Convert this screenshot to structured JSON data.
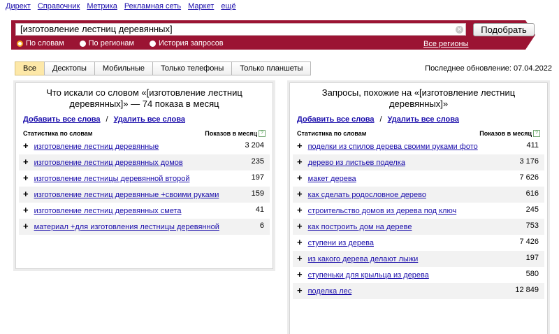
{
  "topnav": [
    {
      "label": "Директ"
    },
    {
      "label": "Справочник"
    },
    {
      "label": "Метрика"
    },
    {
      "label": "Рекламная сеть"
    },
    {
      "label": "Маркет"
    },
    {
      "label": "ещё"
    }
  ],
  "search": {
    "query": "[изготовление лестниц деревянных]",
    "submit_label": "Подобрать",
    "clear_glyph": "✕",
    "modes": [
      {
        "label": "По словам",
        "selected": true
      },
      {
        "label": "По регионам",
        "selected": false
      },
      {
        "label": "История запросов",
        "selected": false
      }
    ],
    "regions_link": "Все регионы"
  },
  "device_tabs": [
    {
      "label": "Все",
      "active": true
    },
    {
      "label": "Десктопы",
      "active": false
    },
    {
      "label": "Мобильные",
      "active": false
    },
    {
      "label": "Только телефоны",
      "active": false
    },
    {
      "label": "Только планшеты",
      "active": false
    }
  ],
  "last_update": "Последнее обновление: 07.04.2022",
  "left_panel": {
    "title": "Что искали со словом «[изготовление лестниц деревянных]» — 74 показа в месяц",
    "add_all": "Добавить все слова",
    "separator": "/",
    "remove_all": "Удалить все слова",
    "col_words": "Статистика по словам",
    "col_shows": "Показов в месяц",
    "help_glyph": "?",
    "rows": [
      {
        "phrase": "изготовление лестниц деревянные",
        "count": "3 204"
      },
      {
        "phrase": "изготовление лестниц деревянных домов",
        "count": "235"
      },
      {
        "phrase": "изготовление лестницы деревянной второй",
        "count": "197"
      },
      {
        "phrase": "изготовление лестниц деревянные +своими руками",
        "count": "159"
      },
      {
        "phrase": "изготовление лестниц деревянных смета",
        "count": "41"
      },
      {
        "phrase": "материал +для изготовления лестницы деревянной",
        "count": "6"
      }
    ]
  },
  "right_panel": {
    "title": "Запросы, похожие на «[изготовление лестниц деревянных]»",
    "add_all": "Добавить все слова",
    "separator": "/",
    "remove_all": "Удалить все слова",
    "col_words": "Статистика по словам",
    "col_shows": "Показов в месяц",
    "help_glyph": "?",
    "rows": [
      {
        "phrase": "поделки из спилов дерева своими руками фото",
        "count": "411"
      },
      {
        "phrase": "дерево из листьев поделка",
        "count": "3 176"
      },
      {
        "phrase": "макет дерева",
        "count": "7 626"
      },
      {
        "phrase": "как сделать родословное дерево",
        "count": "616"
      },
      {
        "phrase": "строительство домов из дерева под ключ",
        "count": "245"
      },
      {
        "phrase": "как построить дом на дереве",
        "count": "753"
      },
      {
        "phrase": "ступени из дерева",
        "count": "7 426"
      },
      {
        "phrase": "из какого дерева делают лыжи",
        "count": "197"
      },
      {
        "phrase": "ступеньки для крыльца из дерева",
        "count": "580"
      },
      {
        "phrase": "поделка лес",
        "count": "12 849"
      }
    ]
  },
  "plus_glyph": "+",
  "colors": {
    "brand": "#9b1433",
    "link": "#1a0dab",
    "active_tab": "#fde8a8",
    "radio_accent": "#f5a623"
  }
}
